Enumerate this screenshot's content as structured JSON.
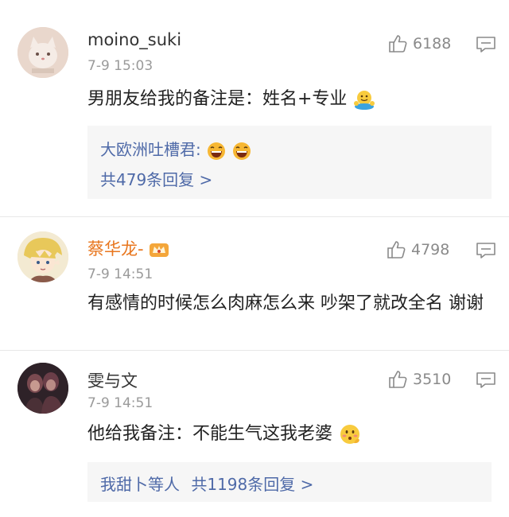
{
  "comments": [
    {
      "username": "moino_suki",
      "time": "7-9 15:03",
      "likes": "6188",
      "text": "男朋友给我的备注是：姓名+专业",
      "reply_preview": "大欧洲吐槽君:",
      "reply_count": "共479条回复 >",
      "avatar_icon": "cat-avatar-icon"
    },
    {
      "username": "蔡华龙-",
      "time": "7-9 14:51",
      "likes": "4798",
      "text": "有感情的时候怎么肉麻怎么来 吵架了就改全名 谢谢",
      "avatar_icon": "anime-boy-avatar-icon"
    },
    {
      "username": "雯与文",
      "time": "7-9 14:51",
      "likes": "3510",
      "text": "他给我备注：不能生气这我老婆",
      "reply_preview": "我甜卜等人",
      "reply_count": "共1198条回复 >",
      "avatar_icon": "dark-photo-avatar-icon"
    }
  ],
  "colors": {
    "username": "#333333",
    "vip_username": "#e8761e",
    "reply_link": "#4f6aa8",
    "meta": "#9a9a9a",
    "reply_bg": "#f6f6f6"
  }
}
